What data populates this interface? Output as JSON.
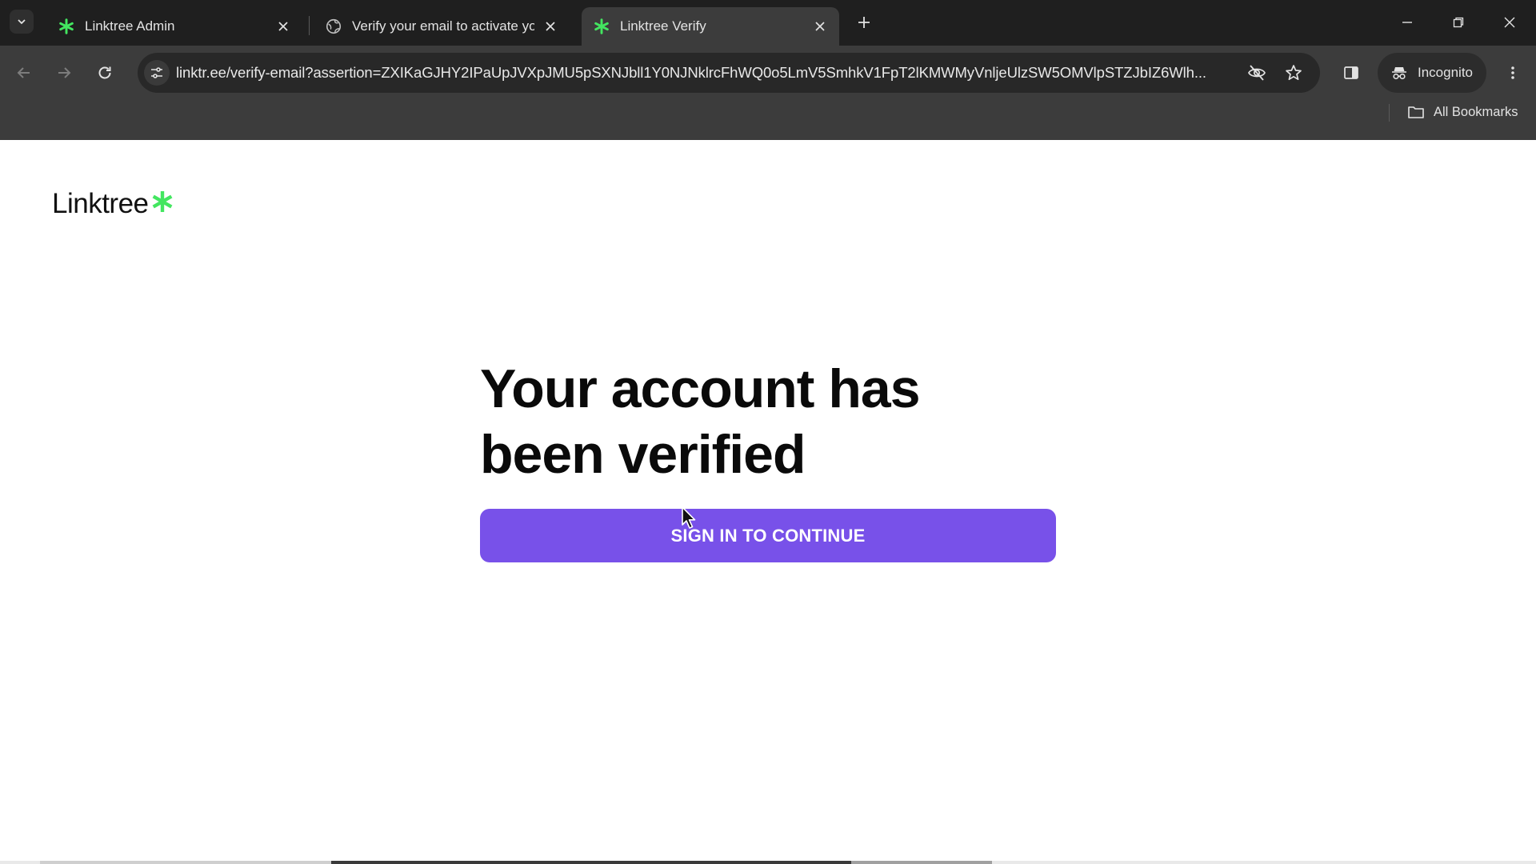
{
  "browser": {
    "tabs": [
      {
        "title": "Linktree Admin",
        "favicon": "linktree-icon",
        "active": false
      },
      {
        "title": "Verify your email to activate yo",
        "favicon": "globe-icon",
        "active": false
      },
      {
        "title": "Linktree Verify",
        "favicon": "linktree-icon",
        "active": true
      }
    ],
    "url": "linktr.ee/verify-email?assertion=ZXIKaGJHY2IPaUpJVXpJMU5pSXNJbll1Y0NJNklrcFhWQ0o5LmV5SmhkV1FpT2lKMWMyVnljeUlzSW5OMVlpSTZJbIZ6Wlh...",
    "incognito_label": "Incognito",
    "bookmarks_label": "All Bookmarks",
    "accent_favicon": "#43e660"
  },
  "page": {
    "logo_text": "Linktree",
    "headline_line1": "Your account has",
    "headline_line2": "been verified",
    "cta_label": "SIGN IN TO CONTINUE",
    "cta_color": "#7851e9"
  }
}
